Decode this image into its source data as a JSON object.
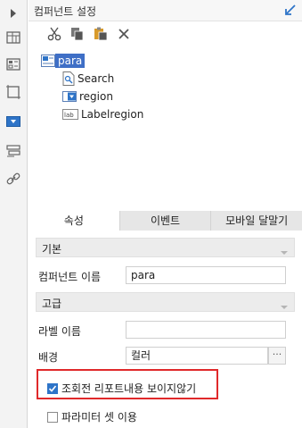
{
  "panel": {
    "title": "컴퍼넌트 설정"
  },
  "left_toolbar": {
    "icons": [
      "expand-arrow-icon",
      "layout-grid-icon",
      "form-grid-icon",
      "frame-icon",
      "combo-dropdown-icon",
      "stack-icon",
      "link-icon"
    ]
  },
  "toolbar": {
    "buttons": [
      "cut-icon",
      "copy-icon",
      "paste-icon",
      "delete-icon"
    ]
  },
  "tree": {
    "root": "para",
    "children": [
      {
        "label": "Search",
        "icon": "search-doc-icon"
      },
      {
        "label": "region",
        "icon": "combo-icon"
      },
      {
        "label": "Labelregion",
        "icon": "label-icon"
      }
    ]
  },
  "tabs": [
    "속성",
    "이벤트",
    "모바일 달말기"
  ],
  "sections": {
    "basic": "기본",
    "advanced": "고급"
  },
  "fields": {
    "component_name_label": "컴퍼넌트 이름",
    "component_name_value": "para",
    "label_name_label": "라벨 이름",
    "label_name_value": "",
    "background_label": "배경",
    "background_value": "컬러",
    "background_more": "···"
  },
  "checkboxes": {
    "hide_before_query": {
      "label": "조회전 리포트내용 보이지않기",
      "checked": true
    },
    "parameter_set": {
      "label": "파라미터 셋 이용",
      "checked": false
    }
  },
  "colors": {
    "accent": "#2e74c8",
    "highlight": "#e0292b",
    "selection": "#3f6fc6"
  }
}
